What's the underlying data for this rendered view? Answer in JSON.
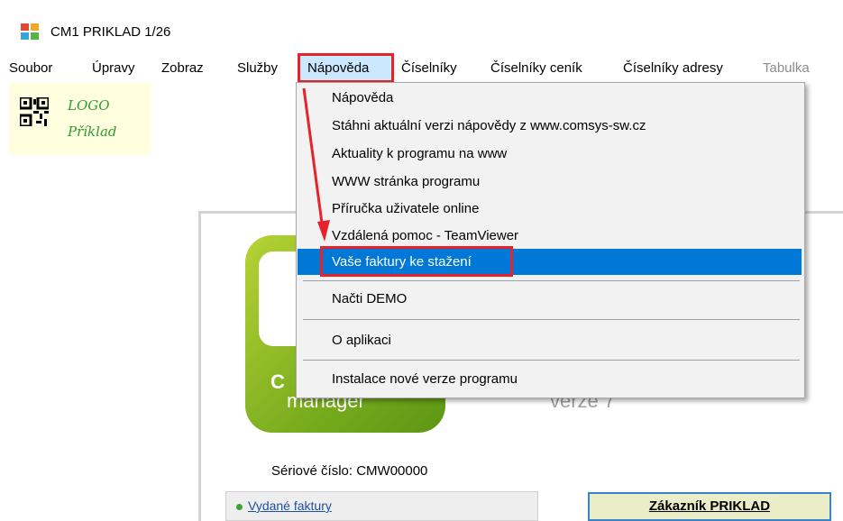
{
  "window": {
    "title": "CM1 PRIKLAD 1/26"
  },
  "menubar": {
    "items": [
      {
        "label": "Soubor"
      },
      {
        "label": "Úpravy"
      },
      {
        "label": "Zobraz"
      },
      {
        "label": "Služby"
      },
      {
        "label": "Nápověda"
      },
      {
        "label": "Číselníky"
      },
      {
        "label": "Číselníky ceník"
      },
      {
        "label": "Číselníky adresy"
      },
      {
        "label": "Tabulka"
      }
    ]
  },
  "logo": {
    "line1": "LOGO",
    "line2": "Příklad"
  },
  "dropdown": {
    "items": [
      {
        "label": "Nápověda"
      },
      {
        "label": "Stáhni aktuální verzi nápovědy z www.comsys-sw.cz"
      },
      {
        "label": "Aktuality k programu na www"
      },
      {
        "label": "WWW stránka programu"
      },
      {
        "label": "Příručka uživatele online"
      },
      {
        "label": "Vzdálená pomoc - TeamViewer"
      },
      {
        "label": "Vaše faktury ke stažení"
      },
      {
        "label": "Načti DEMO"
      },
      {
        "label": "O aplikaci"
      },
      {
        "label": "Instalace nové verze programu"
      }
    ]
  },
  "content": {
    "serial": "Sériové číslo: CMW00000",
    "issued_invoices": "Vydané faktury",
    "customer_button": "Zákazník PRIKLAD"
  },
  "colors": {
    "highlight": "#0078d7",
    "annotation_red": "#e6222b",
    "menu_hover": "#cce8ff"
  }
}
